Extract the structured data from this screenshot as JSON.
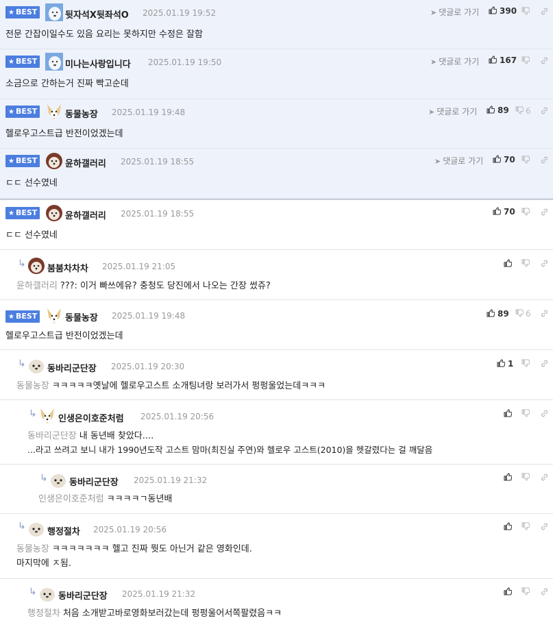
{
  "ui": {
    "best_label": "BEST",
    "goto_label": "댓글로 가기",
    "colors": {
      "best_bg": "#eef2fb",
      "badge": "#4c7ee0",
      "muted": "#999999"
    }
  },
  "best_comments": [
    {
      "nick": "뒷자석X뒷좌석O",
      "date": "2025.01.19 19:52",
      "likes": "390",
      "dislikes": "",
      "text": "전문 간잡이일수도 있음 요리는 못하지만 수정은 잘함",
      "avatar": "polar-bear-avatar"
    },
    {
      "nick": "미나는사랑입니다",
      "date": "2025.01.19 19:50",
      "likes": "167",
      "dislikes": "",
      "text": "소금으로 간하는거 진짜 빡고순데",
      "avatar": "polar-bear-avatar"
    },
    {
      "nick": "동물농장",
      "date": "2025.01.19 19:48",
      "likes": "89",
      "dislikes": "6",
      "text": "헬로우고스트급 반전이었겠는데",
      "avatar": "dog-avatar"
    },
    {
      "nick": "윤하갤러리",
      "date": "2025.01.19 18:55",
      "likes": "70",
      "dislikes": "",
      "text": "ㄷㄷ 선수였네",
      "avatar": "puppy-avatar"
    }
  ],
  "comments": [
    {
      "best": true,
      "nick": "윤하갤러리",
      "date": "2025.01.19 18:55",
      "likes": "70",
      "dislikes": "",
      "parent": "",
      "text": "ㄷㄷ 선수였네",
      "avatar": "puppy-avatar"
    },
    {
      "best": false,
      "nick": "붐붐차차차",
      "date": "2025.01.19 21:05",
      "likes": "",
      "dislikes": "",
      "parent": "윤하갤러리",
      "text": "???: 이거 빠쓰에유? 충청도 당진에서 나오는 간장 썼쥬?",
      "avatar": "puppy-avatar"
    },
    {
      "best": true,
      "nick": "동물농장",
      "date": "2025.01.19 19:48",
      "likes": "89",
      "dislikes": "6",
      "parent": "",
      "text": "헬로우고스트급 반전이었겠는데",
      "avatar": "dog-avatar"
    },
    {
      "best": false,
      "nick": "동바리군단장",
      "date": "2025.01.19 20:30",
      "likes": "1",
      "dislikes": "",
      "parent": "동물농장",
      "text": "ㅋㅋㅋㅋㅋ옛날에 헬로우고스트 소개팅녀랑 보러가서 펑펑울었는데ㅋㅋㅋ",
      "avatar": "seal-avatar"
    },
    {
      "best": false,
      "nick": "인생은이호준처럼",
      "date": "2025.01.19 20:56",
      "likes": "",
      "dislikes": "",
      "parent": "동바리군단장",
      "text": "내 동년배 찾았다....",
      "text2": "...라고 쓰려고 보니 내가 1990년도작 고스트 맘마(최진실 주연)와 헬로우 고스트(2010)을 헷갈렸다는 걸 깨달음",
      "avatar": "dog-avatar"
    },
    {
      "best": false,
      "nick": "동바리군단장",
      "date": "2025.01.19 21:32",
      "likes": "",
      "dislikes": "",
      "parent": "인생은이호준처럼",
      "text": "ㅋㅋㅋㅋㄱ동년배",
      "avatar": "seal-avatar"
    },
    {
      "best": false,
      "nick": "행정절차",
      "date": "2025.01.19 20:56",
      "likes": "",
      "dislikes": "",
      "parent": "동물농장",
      "text": "ㅋㅋㅋㅋㅋㅋㅋ 헬고 진짜 뭣도 아닌거 같은 영화인데.",
      "text2": "마지막에 ㅈ됨.",
      "avatar": "seal-avatar"
    },
    {
      "best": false,
      "nick": "동바리군단장",
      "date": "2025.01.19 21:32",
      "likes": "",
      "dislikes": "",
      "parent": "행정절차",
      "text": "처음 소개받고바로영화보러갔는데 펑펑울어서쪽팔렸음ㅋㅋ",
      "avatar": "seal-avatar"
    }
  ]
}
